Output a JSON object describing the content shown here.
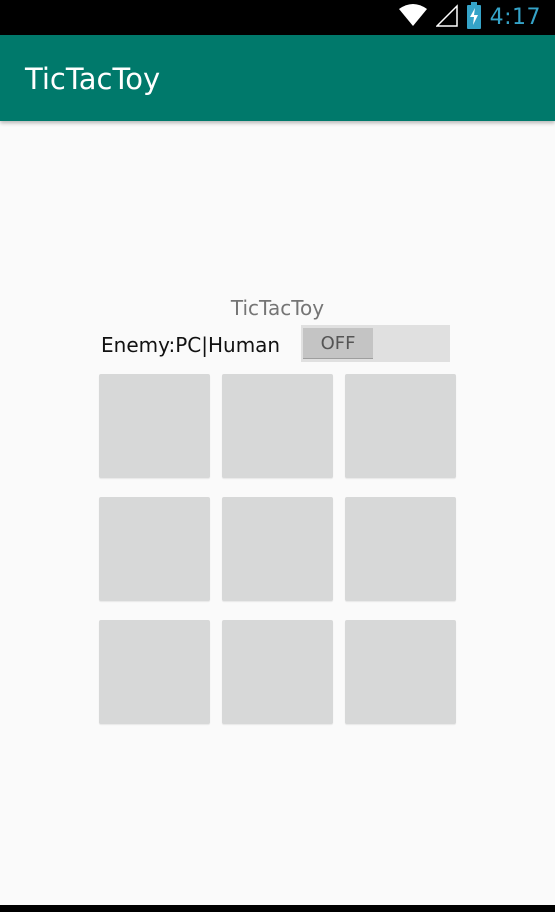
{
  "status_bar": {
    "time": "4:17",
    "icons": [
      "wifi-icon",
      "cell-signal-icon",
      "battery-charging-icon"
    ],
    "accent_color": "#35a3c8"
  },
  "app_bar": {
    "title": "TicTacToy",
    "color": "#00796b"
  },
  "game": {
    "title": "TicTacToy",
    "enemy_label": "Enemy:PC|Human",
    "toggle": {
      "state": "OFF"
    },
    "board": [
      [
        "",
        "",
        ""
      ],
      [
        "",
        "",
        ""
      ],
      [
        "",
        "",
        ""
      ]
    ]
  }
}
